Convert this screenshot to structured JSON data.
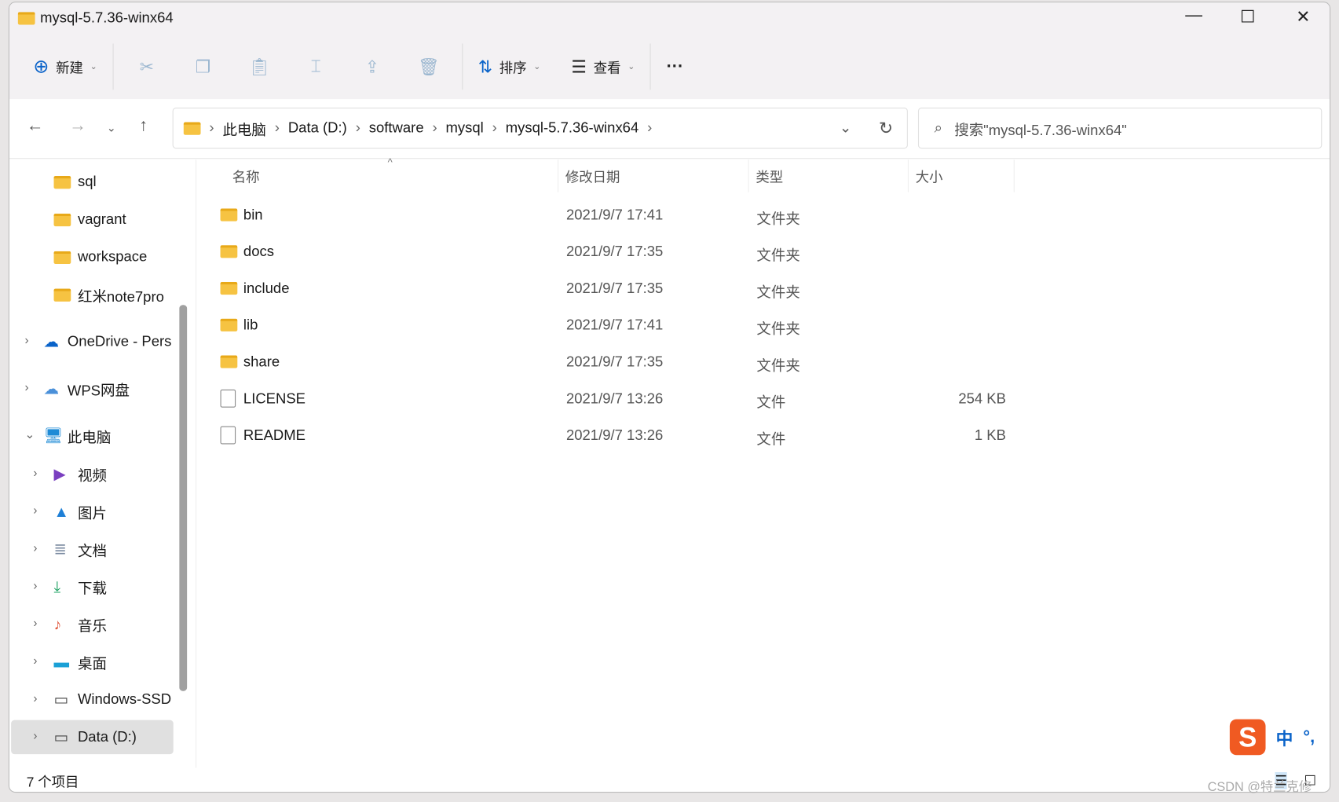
{
  "window": {
    "title": "mysql-5.7.36-winx64",
    "minimize": "—",
    "maximize": "☐",
    "close": "✕"
  },
  "toolbar": {
    "new_label": "新建",
    "sort_label": "排序",
    "view_label": "查看",
    "more": "···"
  },
  "breadcrumb": [
    "此电脑",
    "Data (D:)",
    "software",
    "mysql",
    "mysql-5.7.36-winx64"
  ],
  "search": {
    "placeholder": "搜索\"mysql-5.7.36-winx64\""
  },
  "sidebar": {
    "items": [
      {
        "label": "sql",
        "icon": "folder-icon"
      },
      {
        "label": "vagrant",
        "icon": "folder-icon"
      },
      {
        "label": "workspace",
        "icon": "folder-icon"
      },
      {
        "label": "红米note7pro",
        "icon": "folder-icon"
      },
      {
        "label": "OneDrive - Pers",
        "icon": "cloud-icon"
      },
      {
        "label": "WPS网盘",
        "icon": "cloud-outline-icon"
      },
      {
        "label": "此电脑",
        "icon": "computer-icon"
      },
      {
        "label": "视频",
        "icon": "video-icon"
      },
      {
        "label": "图片",
        "icon": "picture-icon"
      },
      {
        "label": "文档",
        "icon": "document-icon"
      },
      {
        "label": "下载",
        "icon": "download-icon"
      },
      {
        "label": "音乐",
        "icon": "music-icon"
      },
      {
        "label": "桌面",
        "icon": "desktop-icon"
      },
      {
        "label": "Windows-SSD",
        "icon": "drive-icon"
      },
      {
        "label": "Data (D:)",
        "icon": "drive-icon",
        "selected": true
      }
    ]
  },
  "columns": [
    "名称",
    "修改日期",
    "类型",
    "大小"
  ],
  "files": [
    {
      "name": "bin",
      "date": "2021/9/7 17:41",
      "type": "文件夹",
      "size": "",
      "folder": true
    },
    {
      "name": "docs",
      "date": "2021/9/7 17:35",
      "type": "文件夹",
      "size": "",
      "folder": true
    },
    {
      "name": "include",
      "date": "2021/9/7 17:35",
      "type": "文件夹",
      "size": "",
      "folder": true
    },
    {
      "name": "lib",
      "date": "2021/9/7 17:41",
      "type": "文件夹",
      "size": "",
      "folder": true
    },
    {
      "name": "share",
      "date": "2021/9/7 17:35",
      "type": "文件夹",
      "size": "",
      "folder": true
    },
    {
      "name": "LICENSE",
      "date": "2021/9/7 13:26",
      "type": "文件",
      "size": "254 KB",
      "folder": false
    },
    {
      "name": "README",
      "date": "2021/9/7 13:26",
      "type": "文件",
      "size": "1 KB",
      "folder": false
    }
  ],
  "status": {
    "count": "7 个项目"
  },
  "ime": {
    "logo": "S",
    "mode": "中",
    "punct": "°,"
  },
  "watermark": "CSDN @特兰克修",
  "colors": {
    "accent": "#0a63c9",
    "folder": "#f6c342"
  }
}
